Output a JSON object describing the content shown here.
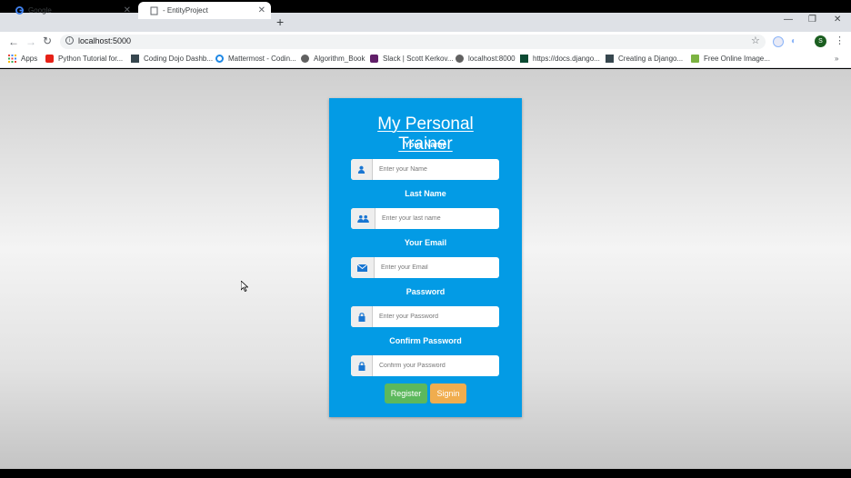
{
  "browser": {
    "tabs": [
      {
        "title": "Google"
      },
      {
        "title": "- EntityProject"
      }
    ],
    "url": "localhost:5000",
    "profile_initial": "S",
    "bookmarks": [
      {
        "label": "Apps"
      },
      {
        "label": "Python Tutorial for..."
      },
      {
        "label": "Coding Dojo Dashb..."
      },
      {
        "label": "Mattermost - Codin..."
      },
      {
        "label": "Algorithm_Book"
      },
      {
        "label": "Slack | Scott Kerkov..."
      },
      {
        "label": "localhost:8000"
      },
      {
        "label": "https://docs.django..."
      },
      {
        "label": "Creating a Django..."
      },
      {
        "label": "Free Online Image..."
      }
    ]
  },
  "form": {
    "title": "My Personal Trainer",
    "fields": [
      {
        "label": "Your Name",
        "placeholder": "Enter your Name",
        "icon": "user-icon"
      },
      {
        "label": "Last Name",
        "placeholder": "Enter your last name",
        "icon": "users-icon"
      },
      {
        "label": "Your Email",
        "placeholder": "Enter your Email",
        "icon": "envelope-icon"
      },
      {
        "label": "Password",
        "placeholder": "Enter your Password",
        "icon": "lock-icon"
      },
      {
        "label": "Confirm Password",
        "placeholder": "Confirm your Password",
        "icon": "lock-icon"
      }
    ],
    "register_label": "Register",
    "signin_label": "Signin"
  },
  "colors": {
    "card": "#039be5",
    "register": "#5cb85c",
    "signin": "#f0ad4e"
  }
}
